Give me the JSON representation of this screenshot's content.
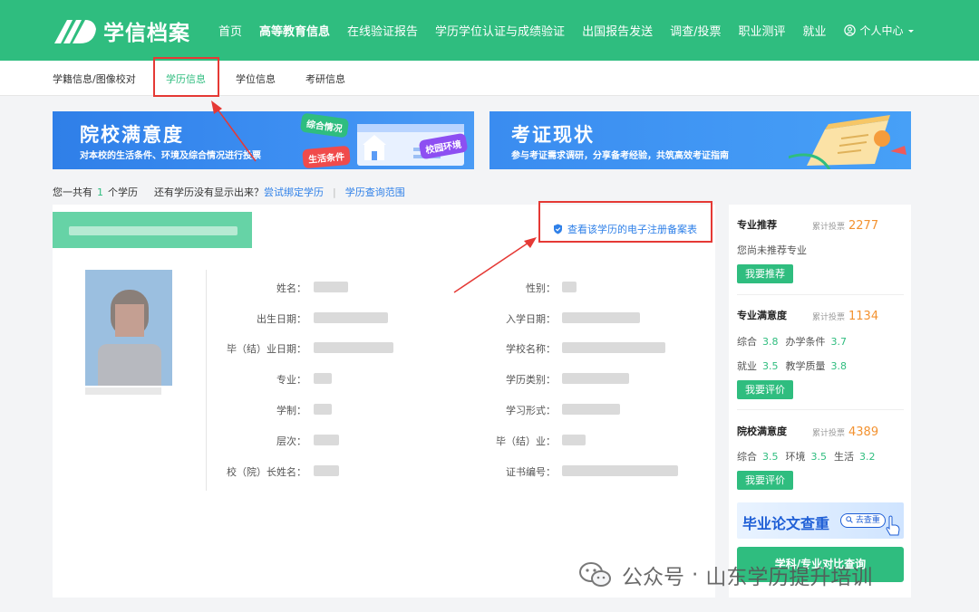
{
  "brand": {
    "name": "学信档案"
  },
  "nav": {
    "items": [
      "首页",
      "高等教育信息",
      "在线验证报告",
      "学历学位认证与成绩验证",
      "出国报告发送",
      "调查/投票",
      "职业测评",
      "就业"
    ],
    "active_index": 1,
    "user_label": "个人中心"
  },
  "subnav": {
    "items": [
      "学籍信息/图像校对",
      "学历信息",
      "学位信息",
      "考研信息"
    ],
    "active_index": 1
  },
  "banners": {
    "left": {
      "title": "院校满意度",
      "subtitle": "对本校的生活条件、环境及综合情况进行投票",
      "tags": [
        "综合情况",
        "生活条件",
        "校园环境"
      ]
    },
    "right": {
      "title": "考证现状",
      "subtitle": "参与考证需求调研，分享备考经验，共筑高效考证指南"
    }
  },
  "summary": {
    "prefix": "您一共有",
    "count": "1",
    "suffix": "个学历",
    "missing_text": "还有学历没有显示出来？",
    "bind_link": "尝试绑定学历",
    "separator": "|",
    "range_link": "学历查询范围"
  },
  "record": {
    "reg_link": "查看该学历的电子注册备案表",
    "fields_left": [
      "姓名：",
      "出生日期：",
      "毕（结）业日期：",
      "专业：",
      "学制：",
      "层次：",
      "校（院）长姓名："
    ],
    "fields_right": [
      "性别：",
      "入学日期：",
      "学校名称：",
      "学历类别：",
      "学习形式：",
      "毕（结）业：",
      "证书编号："
    ]
  },
  "sidebar": {
    "major_recommend": {
      "title": "专业推荐",
      "votes_label": "累计投票",
      "votes": "2277",
      "empty_text": "您尚未推荐专业",
      "button": "我要推荐"
    },
    "major_satisfaction": {
      "title": "专业满意度",
      "votes_label": "累计投票",
      "votes": "1134",
      "row1": [
        {
          "label": "综合",
          "score": "3.8"
        },
        {
          "label": "办学条件",
          "score": "3.7"
        }
      ],
      "row2": [
        {
          "label": "就业",
          "score": "3.5"
        },
        {
          "label": "教学质量",
          "score": "3.8"
        }
      ],
      "button": "我要评价"
    },
    "school_satisfaction": {
      "title": "院校满意度",
      "votes_label": "累计投票",
      "votes": "4389",
      "row1": [
        {
          "label": "综合",
          "score": "3.5"
        },
        {
          "label": "环境",
          "score": "3.5"
        },
        {
          "label": "生活",
          "score": "3.2"
        }
      ],
      "button": "我要评价"
    },
    "thesis": {
      "title": "毕业论文查重",
      "pill": "去查重"
    },
    "query_button": "学科/专业对比查询"
  },
  "watermark": {
    "channel": "公众号",
    "dot": "·",
    "name": "山东学历提升培训"
  },
  "colors": {
    "brand_green": "#2fbd7f",
    "link_blue": "#2f80e8",
    "highlight_red": "#e53935",
    "vote_orange": "#f39230"
  }
}
